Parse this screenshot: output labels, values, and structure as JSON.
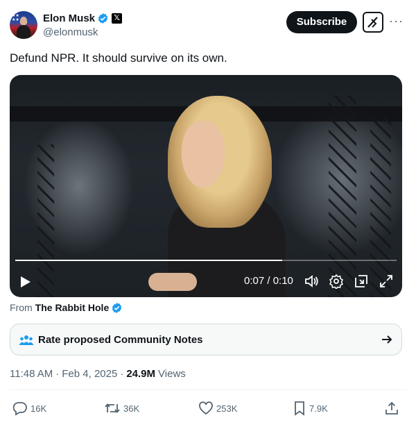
{
  "author": {
    "display_name": "Elon Musk",
    "handle": "@elonmusk"
  },
  "header": {
    "subscribe_label": "Subscribe",
    "more_label": "···"
  },
  "tweet": {
    "text": "Defund NPR. It should survive on its own."
  },
  "video": {
    "time_label": "0:07 / 0:10",
    "progress": 0.7
  },
  "attribution": {
    "prefix": "From",
    "source": "The Rabbit Hole"
  },
  "community_notes": {
    "label": "Rate proposed Community Notes"
  },
  "meta": {
    "time": "11:48 AM",
    "date": "Feb 4, 2025",
    "separator": "·",
    "views_count": "24.9M",
    "views_label": "Views"
  },
  "actions": {
    "replies": "16K",
    "reposts": "36K",
    "likes": "253K",
    "bookmarks": "7.9K"
  },
  "colors": {
    "verified": "#1d9bf0",
    "text": "#0f1419",
    "secondary": "#536471"
  },
  "icons": [
    "verified-badge-icon",
    "x-logo-icon",
    "grok-icon",
    "more-icon",
    "play-icon",
    "volume-icon",
    "settings-icon",
    "pip-icon",
    "fullscreen-icon",
    "community-icon",
    "arrow-right-icon",
    "reply-icon",
    "repost-icon",
    "like-icon",
    "bookmark-icon",
    "share-icon"
  ]
}
